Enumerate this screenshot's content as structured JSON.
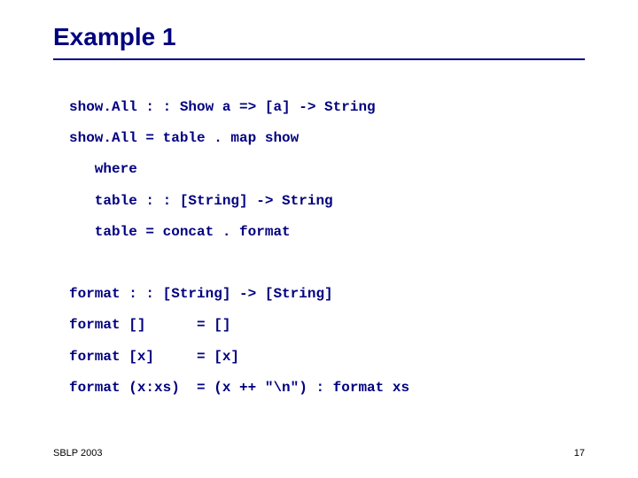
{
  "title": "Example 1",
  "code": {
    "l1": "show.All : : Show a => [a] -> String",
    "l2": "show.All = table . map show",
    "l3": "   where",
    "l4": "   table : : [String] -> String",
    "l5": "   table = concat . format",
    "gap1": " ",
    "l6": "format : : [String] -> [String]",
    "l7": "format []      = []",
    "l8": "format [x]     = [x]",
    "l9": "format (x:xs)  = (x ++ \"\\n\") : format xs"
  },
  "footer": {
    "left": "SBLP 2003",
    "right": "17"
  }
}
